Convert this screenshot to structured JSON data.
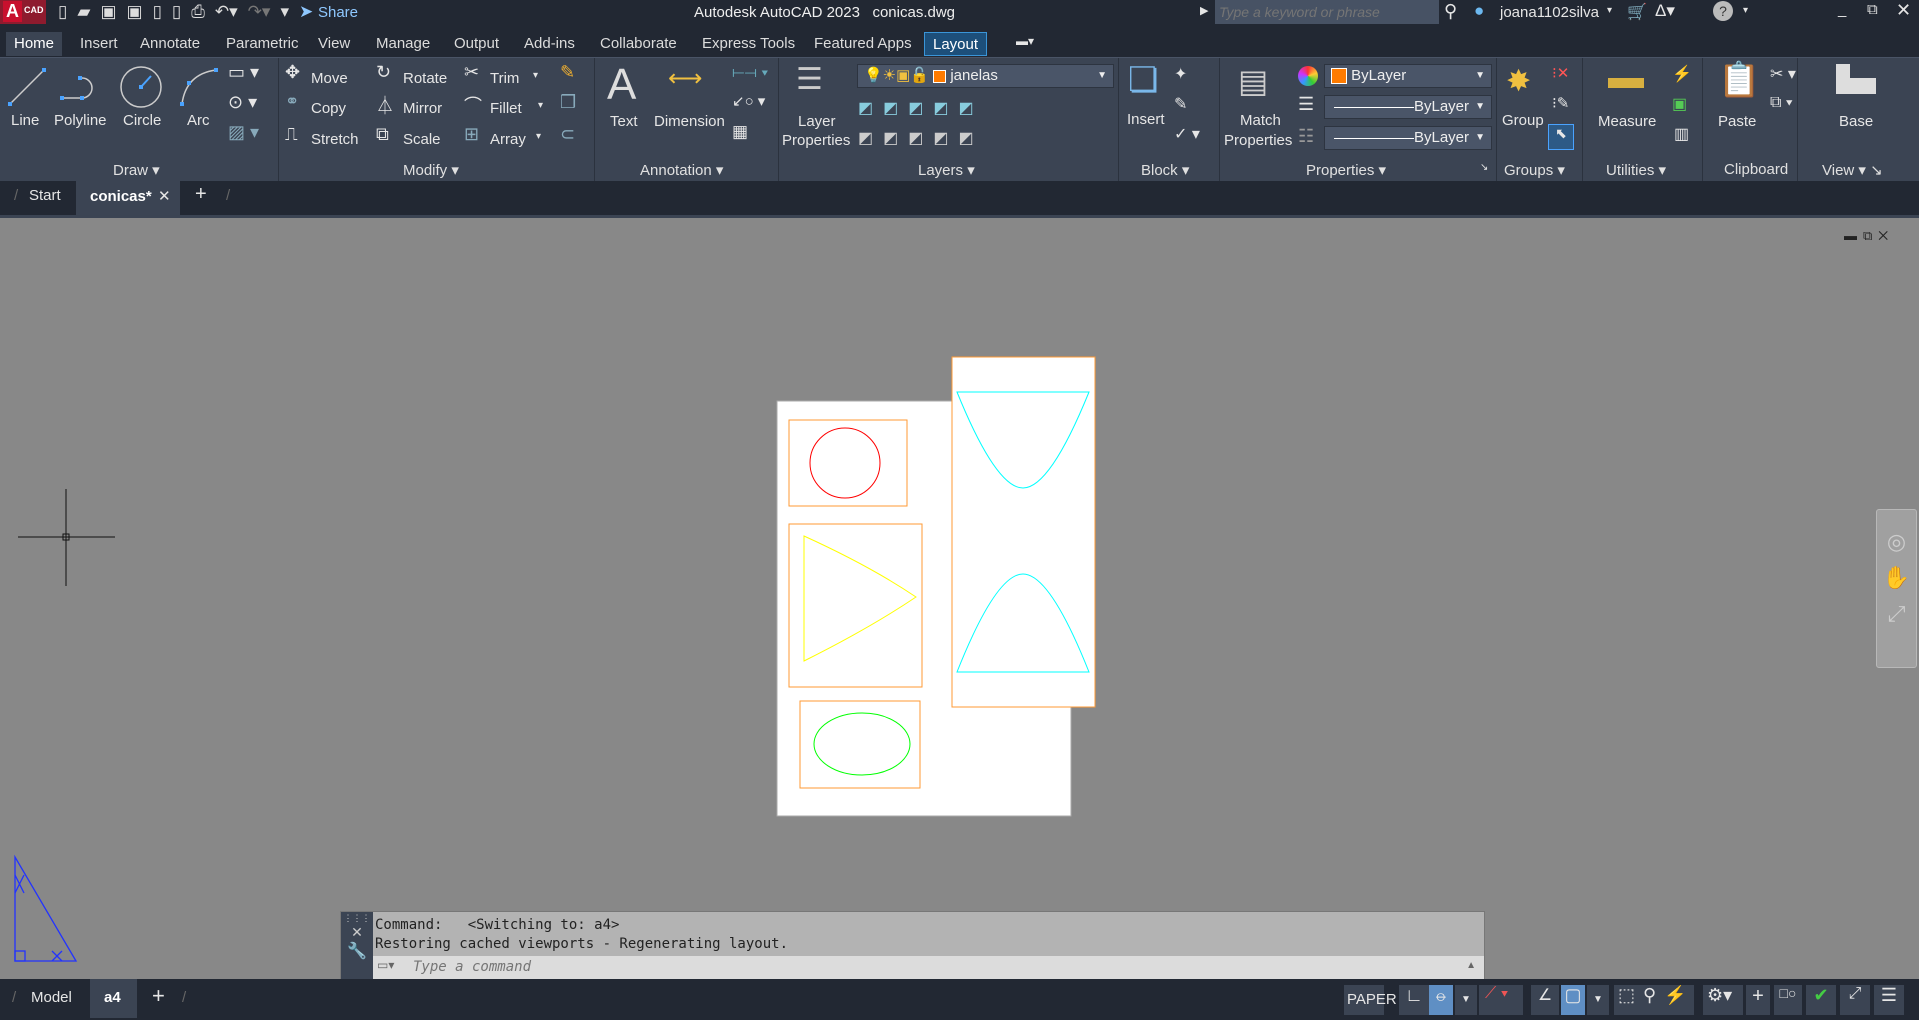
{
  "app": {
    "logo_letter": "A",
    "logo_text": "CAD",
    "title": "Autodesk AutoCAD 2023",
    "file": "conicas.dwg",
    "share_label": "Share",
    "search_placeholder": "Type a keyword or phrase",
    "user": "joana1102silva"
  },
  "ribbon_tabs": [
    "Home",
    "Insert",
    "Annotate",
    "Parametric",
    "View",
    "Manage",
    "Output",
    "Add-ins",
    "Collaborate",
    "Express Tools",
    "Featured Apps",
    "Layout"
  ],
  "active_tab": "Home",
  "panels": {
    "draw": {
      "label": "Draw",
      "tools": [
        "Line",
        "Polyline",
        "Circle",
        "Arc"
      ]
    },
    "modify": {
      "label": "Modify",
      "tools": [
        "Move",
        "Rotate",
        "Trim",
        "Copy",
        "Mirror",
        "Fillet",
        "Stretch",
        "Scale",
        "Array"
      ]
    },
    "annotation": {
      "label": "Annotation",
      "tools": [
        "Text",
        "Dimension"
      ]
    },
    "layers": {
      "label": "Layers",
      "layer_properties": "Layer",
      "layer_properties2": "Properties",
      "current_layer": "janelas",
      "layer_color": "#ff7b00"
    },
    "block": {
      "label": "Block",
      "insert": "Insert"
    },
    "properties": {
      "label": "Properties",
      "match1": "Match",
      "match2": "Properties",
      "color": "ByLayer",
      "linetype": "ByLayer",
      "lineweight": "ByLayer",
      "color_swatch": "#ff7b00"
    },
    "groups": {
      "label": "Groups",
      "group": "Group"
    },
    "utilities": {
      "label": "Utilities",
      "measure": "Measure"
    },
    "clipboard": {
      "label": "Clipboard",
      "paste": "Paste"
    },
    "view": {
      "label": "View",
      "base": "Base"
    }
  },
  "doc_tabs": {
    "start": "Start",
    "current": "conicas*"
  },
  "command": {
    "line1": "Command:   <Switching to: a4>",
    "line2": "Restoring cached viewports - Regenerating layout.",
    "placeholder": "Type a command"
  },
  "layout_tabs": {
    "model": "Model",
    "active": "a4"
  },
  "status": {
    "space": "PAPER"
  },
  "colors": {
    "circle": "#ff0000",
    "parabola": "#ffff00",
    "ellipse": "#00ff00",
    "hyperbola": "#00ffff",
    "viewport_border": "#ff9a33",
    "ucs": "#2233ff"
  }
}
